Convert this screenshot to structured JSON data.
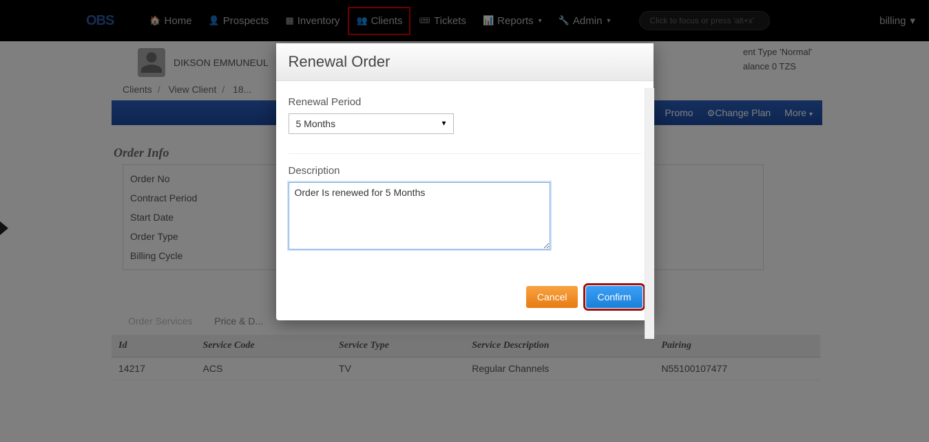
{
  "nav": {
    "logo": "OBS",
    "home": "Home",
    "prospects": "Prospects",
    "inventory": "Inventory",
    "clients": "Clients",
    "tickets": "Tickets",
    "reports": "Reports",
    "admin": "Admin",
    "search_placeholder": "Click to focus or press 'alt+x'",
    "right_user": "billing"
  },
  "client": {
    "name": "DIKSON EMMUNEUL",
    "type_label": "ent Type",
    "type_value": "'Normal'",
    "balance_label": "alance",
    "balance_value": "0 TZS"
  },
  "breadcrumbs": {
    "clients": "Clients",
    "view_client": "View Client",
    "id": "18..."
  },
  "bluebar": {
    "promo": "Promo",
    "change_plan": "Change Plan",
    "more": "More"
  },
  "order_info": {
    "heading": "Order Info",
    "labels": {
      "order_no": "Order No",
      "contract_period": "Contract Period",
      "start_date": "Start Date",
      "order_type": "Order Type",
      "billing_cycle": "Billing Cycle"
    }
  },
  "services_tabs": {
    "order_services": "Order Services",
    "price_details": "Price & D..."
  },
  "service_table": {
    "headers": {
      "id": "Id",
      "service_code": "Service Code",
      "service_type": "Service Type",
      "service_description": "Service Description",
      "pairing": "Pairing"
    },
    "row": {
      "id": "14217",
      "service_code": "ACS",
      "service_type": "TV",
      "service_description": "Regular Channels",
      "pairing": "N55100107477"
    }
  },
  "modal": {
    "title": "Renewal Order",
    "renewal_period_label": "Renewal Period",
    "renewal_period_value": "5 Months",
    "description_label": "Description",
    "description_value": "Order Is renewed for 5 Months",
    "cancel": "Cancel",
    "confirm": "Confirm"
  }
}
